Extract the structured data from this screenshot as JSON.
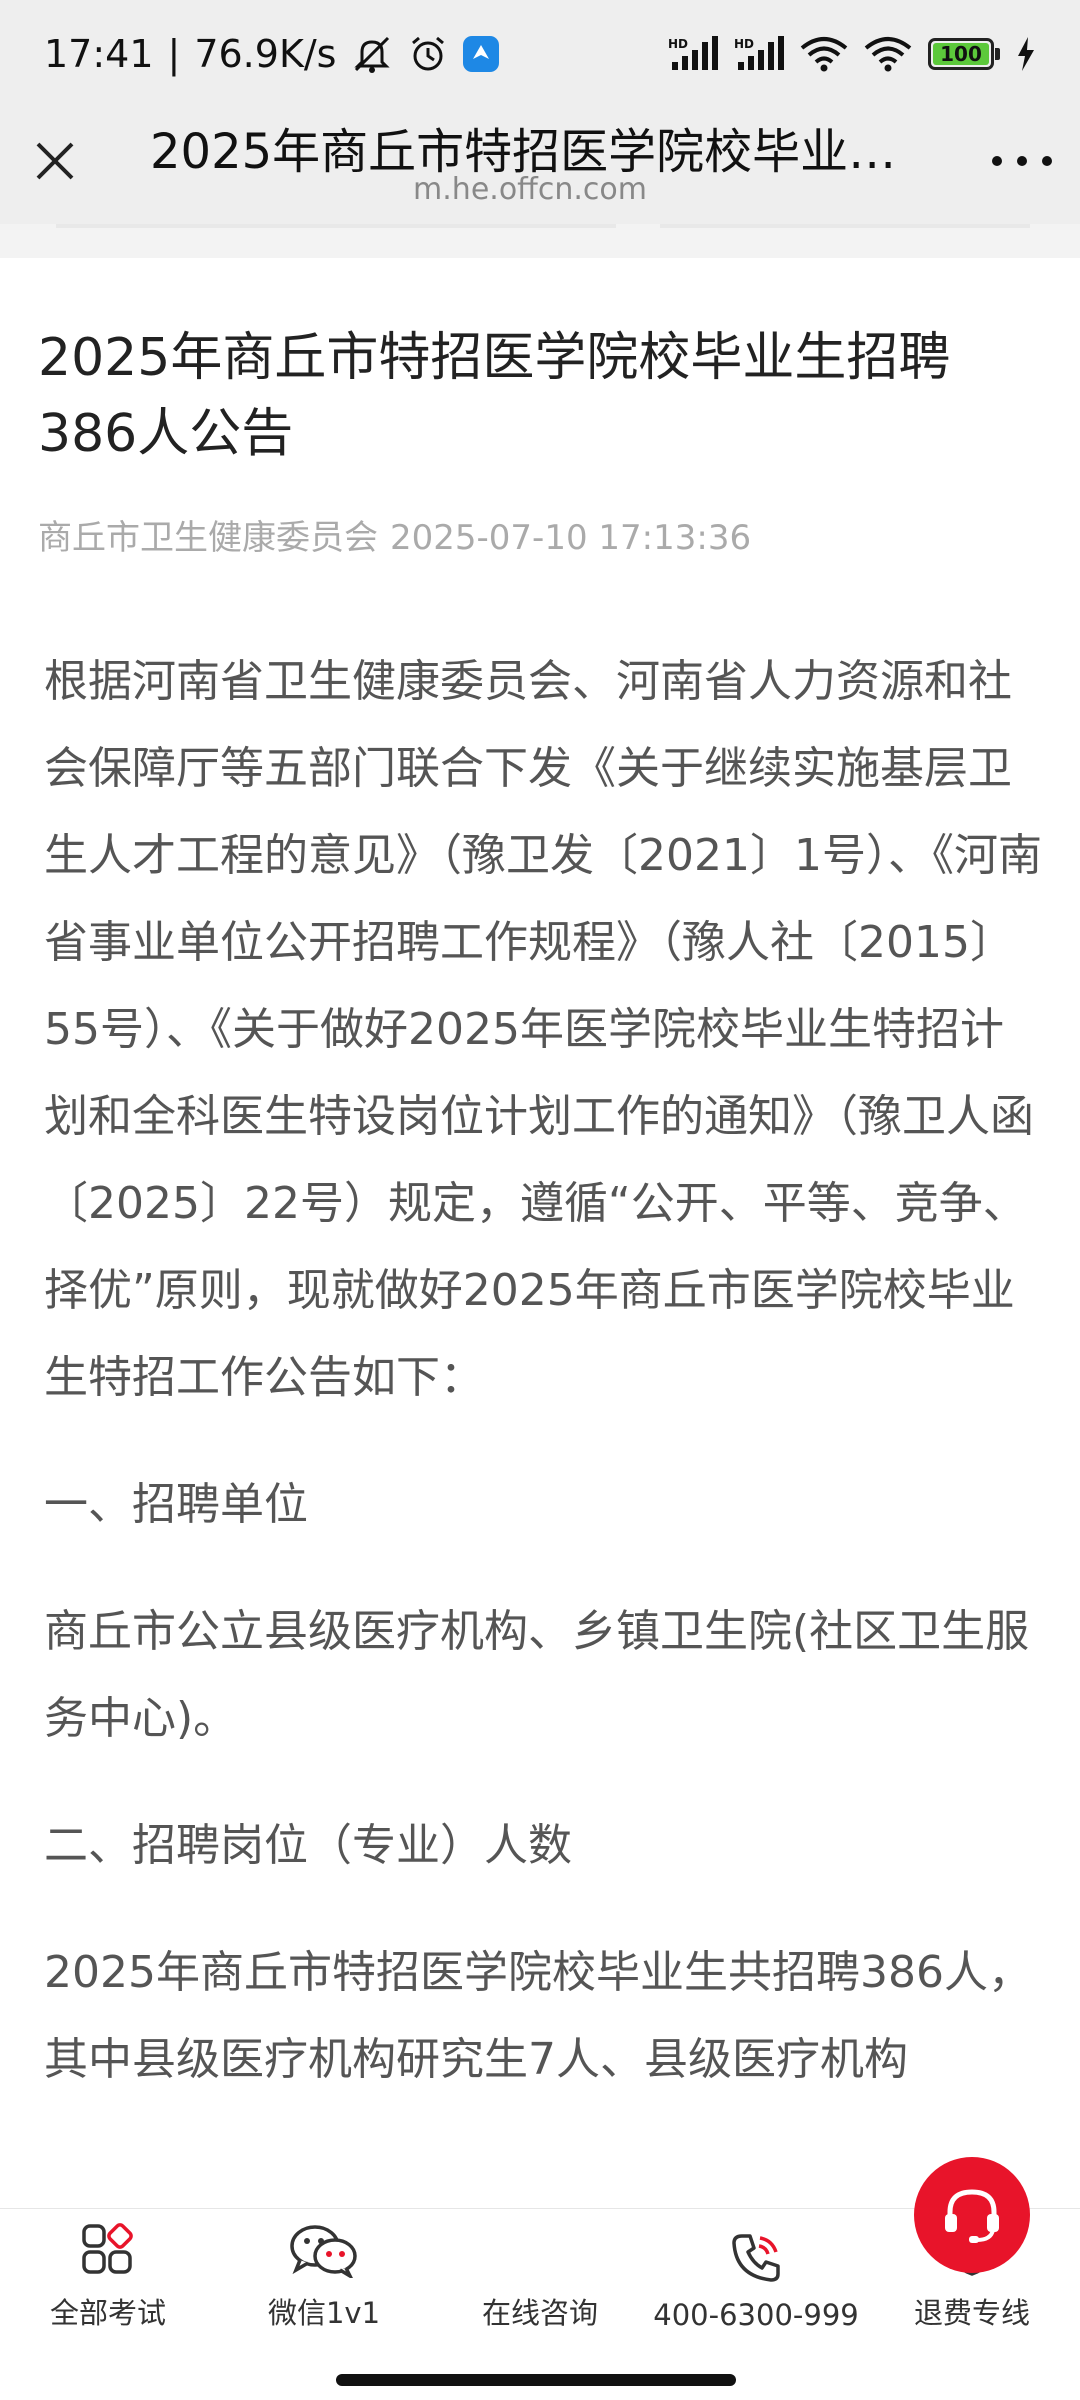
{
  "status_bar": {
    "time": "17:41",
    "separator": "|",
    "net_speed": "76.9K/s",
    "battery_level": "100",
    "icons": [
      "mute-icon",
      "alarm-icon",
      "app-notification-icon",
      "signal-hd-icon",
      "signal-hd-icon",
      "wifi-icon",
      "wifi-icon",
      "battery-icon",
      "charging-icon"
    ]
  },
  "nav": {
    "title": "2025年商丘市特招医学院校毕业生...",
    "url": "m.he.offcn.com",
    "close_icon": "close-icon",
    "more_icon": "more-icon"
  },
  "article": {
    "title": "2025年商丘市特招医学院校毕业生招聘386人公告",
    "source": "商丘市卫生健康委员会",
    "datetime": "2025-07-10 17:13:36",
    "paragraphs": [
      "根据河南省卫生健康委员会、河南省人力资源和社会保障厅等五部门联合下发《关于继续实施基层卫生人才工程的意见》（豫卫发〔2021〕1号）、《河南省事业单位公开招聘工作规程》（豫人社〔2015〕55号）、《关于做好2025年医学院校毕业生特招计划和全科医生特设岗位计划工作的通知》（豫卫人函〔2025〕22号）规定，遵循“公开、平等、竞争、择优”原则，现就做好2025年商丘市医学院校毕业生特招工作公告如下：",
      "一、招聘单位",
      "商丘市公立县级医疗机构、乡镇卫生院(社区卫生服务中心)。",
      "二、招聘岗位（专业）人数",
      "2025年商丘市特招医学院校毕业生共招聘386人，其中县级医疗机构研究生7人、县级医疗机构"
    ]
  },
  "bottom_bar": {
    "tabs": [
      {
        "label": "全部考试",
        "icon": "grid-icon"
      },
      {
        "label": "微信1v1",
        "icon": "wechat-icon"
      },
      {
        "label": "在线咨询",
        "icon": "headset-icon"
      },
      {
        "label": "400-6300-999",
        "icon": "phone-icon"
      },
      {
        "label": "退费专线",
        "icon": "shield-check-icon"
      }
    ]
  },
  "colors": {
    "accent_red": "#e8142a",
    "status_bg": "#eeeeee",
    "battery_green": "#5cc93b",
    "meta_gray": "#aaaaaa",
    "body_text": "#555555"
  }
}
